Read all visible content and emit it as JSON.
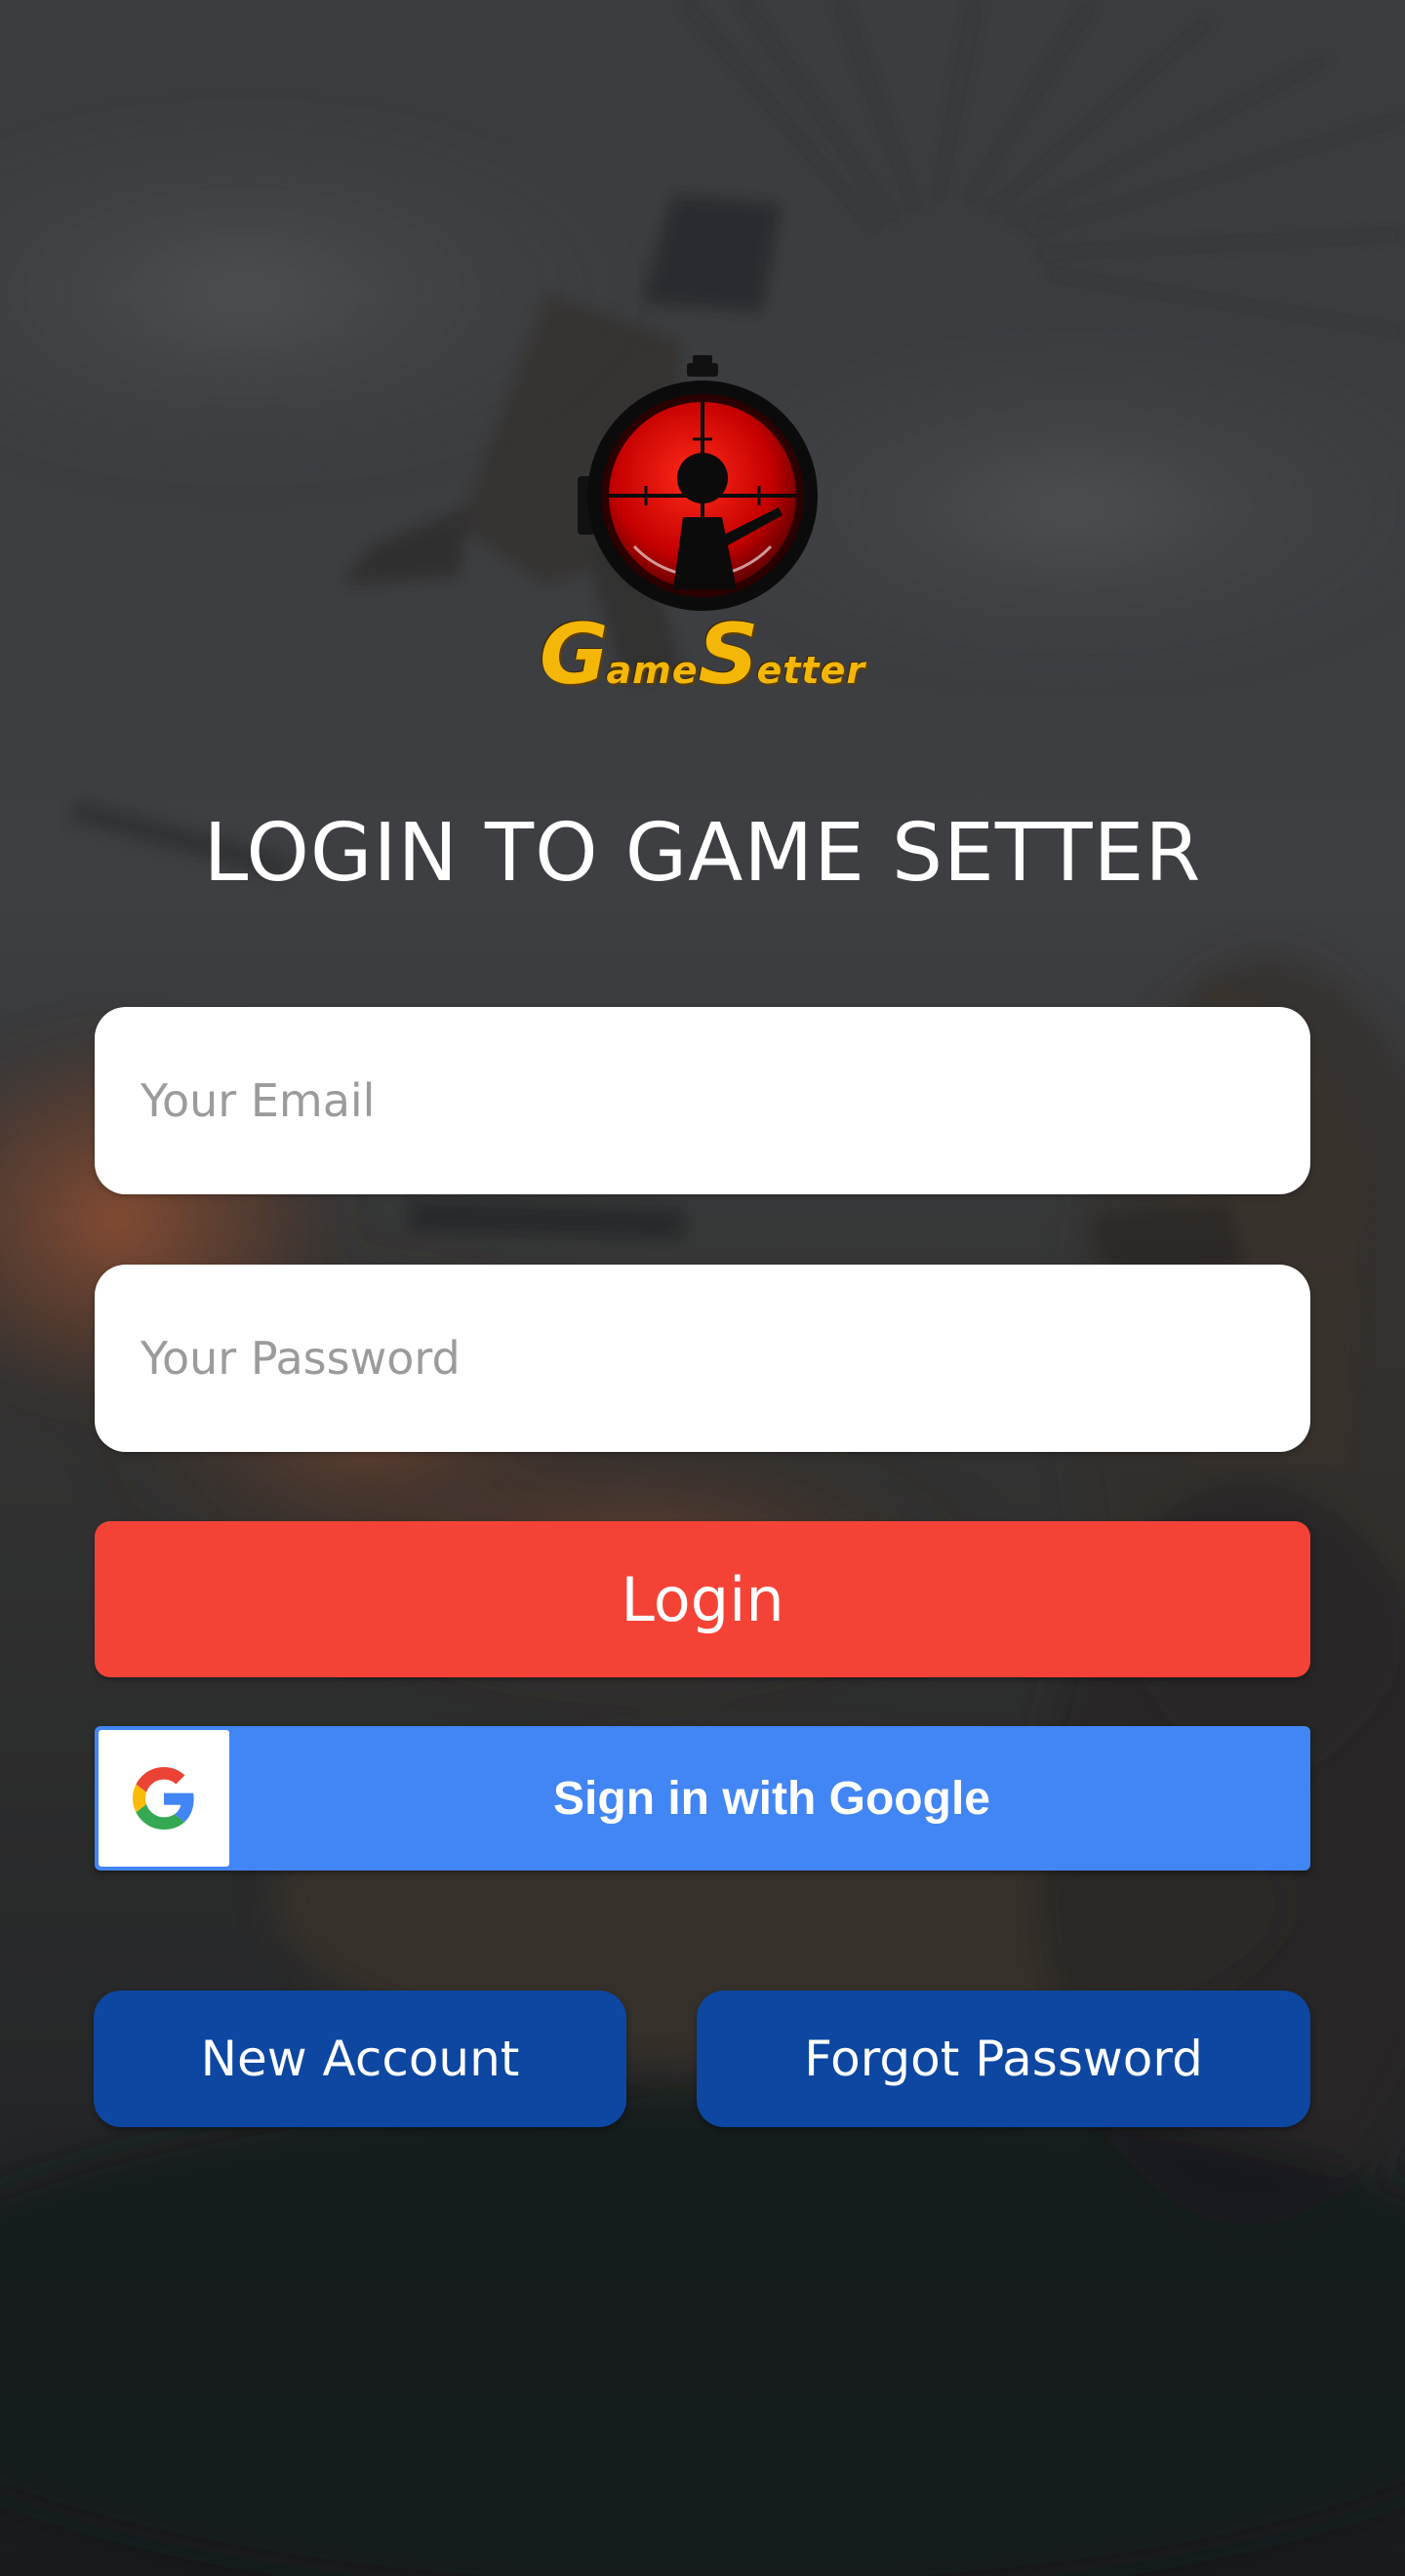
{
  "background": {
    "scene": "blurred-battle-scene-with-parachute",
    "overlay_color": "#1e1f22"
  },
  "logo": {
    "icon": "sniper-scope-icon",
    "text_first_initial": "G",
    "text_first_rest": "ame",
    "text_second_initial": "S",
    "text_second_rest": "etter",
    "brand_color": "#f4b707",
    "scope_color": "#d90000"
  },
  "header": {
    "title": "LOGIN TO GAME SETTER"
  },
  "form": {
    "email": {
      "placeholder": "Your Email",
      "value": ""
    },
    "password": {
      "placeholder": "Your Password",
      "value": ""
    },
    "login_label": "Login",
    "login_color": "#f44336"
  },
  "google": {
    "label": "Sign in with Google",
    "icon": "google-g-icon",
    "color": "#4285f4"
  },
  "footer": {
    "new_account_label": "New Account",
    "forgot_password_label": "Forgot Password",
    "button_color": "#0d47a1"
  }
}
